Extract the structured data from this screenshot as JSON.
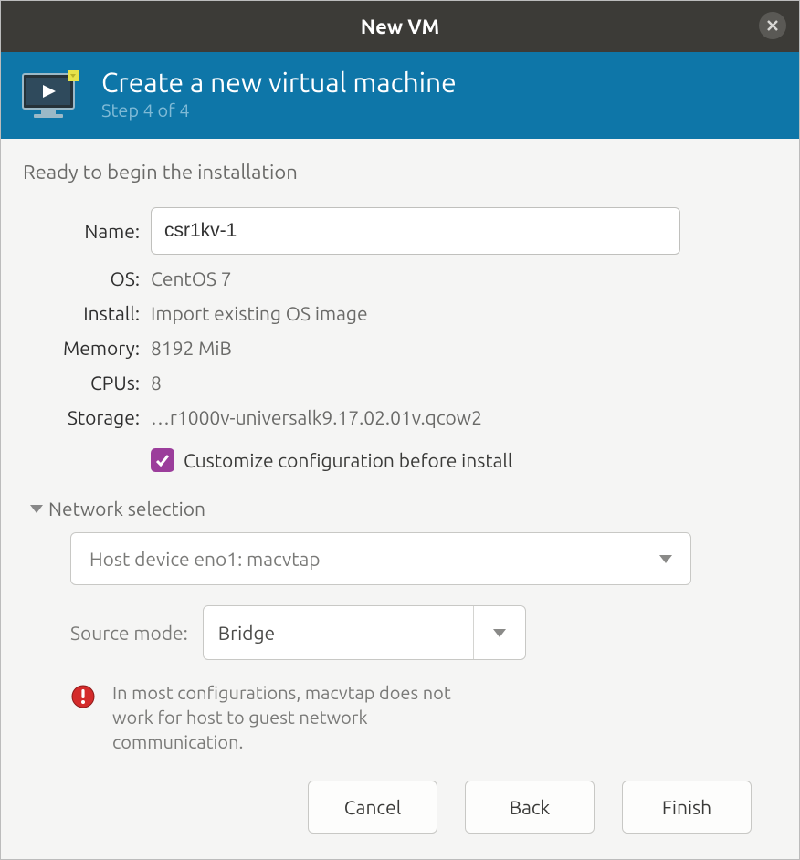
{
  "title": "New VM",
  "banner": {
    "heading": "Create a new virtual machine",
    "step": "Step 4 of 4"
  },
  "subheading": "Ready to begin the installation",
  "labels": {
    "name": "Name:",
    "os": "OS:",
    "install": "Install:",
    "memory": "Memory:",
    "cpus": "CPUs:",
    "storage": "Storage:"
  },
  "values": {
    "name": "csr1kv-1",
    "os": "CentOS 7",
    "install": "Import existing OS image",
    "memory": "8192 MiB",
    "cpus": "8",
    "storage": "…r1000v-universalk9.17.02.01v.qcow2"
  },
  "customize": {
    "checked": true,
    "label": "Customize configuration before install"
  },
  "network": {
    "title": "Network selection",
    "device": "Host device eno1: macvtap",
    "source_mode_label": "Source mode:",
    "source_mode_value": "Bridge",
    "warning": "In most configurations, macvtap does not work for host to guest network communication."
  },
  "buttons": {
    "cancel": "Cancel",
    "back": "Back",
    "finish": "Finish"
  }
}
